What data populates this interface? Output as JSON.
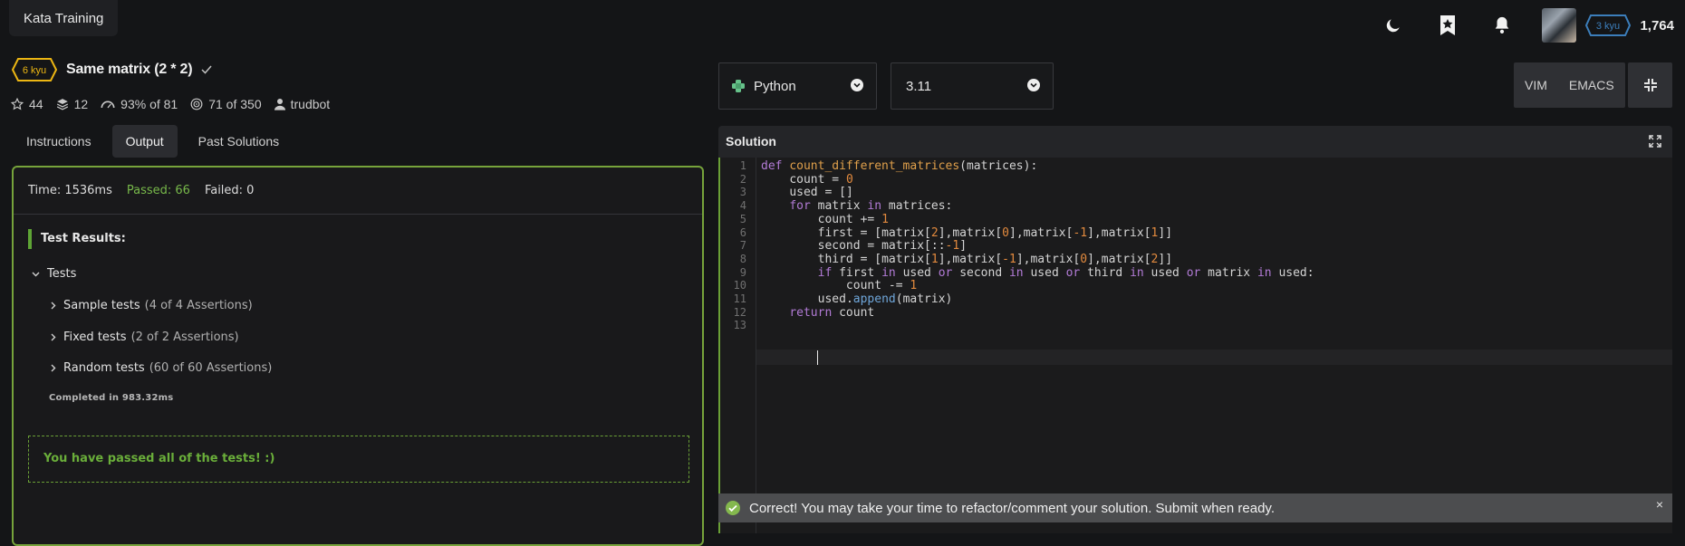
{
  "app": {
    "brand": "Kata Training"
  },
  "user": {
    "rank": "3 kyu",
    "honor": "1,764"
  },
  "kata": {
    "rank": "6 kyu",
    "title": "Same matrix (2 * 2)",
    "stats": {
      "stars": "44",
      "collections": "12",
      "satisfaction": "93% of 81",
      "completions": "71 of 350",
      "author": "trudbot"
    }
  },
  "tabs": [
    "Instructions",
    "Output",
    "Past Solutions"
  ],
  "output": {
    "time": "Time: 1536ms",
    "passed": "Passed: 66",
    "failed": "Failed: 0",
    "results_title": "Test Results:",
    "tests_label": "Tests",
    "groups": [
      {
        "name": "Sample tests",
        "detail": "(4 of 4 Assertions)"
      },
      {
        "name": "Fixed tests",
        "detail": "(2 of 2 Assertions)"
      },
      {
        "name": "Random tests",
        "detail": "(60 of 60 Assertions)"
      }
    ],
    "completed": "Completed in 983.32ms",
    "pass_message": "You have passed all of the tests! :)"
  },
  "editor": {
    "language": "Python",
    "version": "3.11",
    "modes": [
      "VIM",
      "EMACS"
    ],
    "panel_title": "Solution",
    "line_numbers": [
      "1",
      "2",
      "3",
      "4",
      "5",
      "6",
      "7",
      "8",
      "9",
      "10",
      "11",
      "12",
      "13"
    ],
    "code_lines": [
      "def count_different_matrices(matrices):",
      "    count = 0",
      "    used = []",
      "    for matrix in matrices:",
      "        count += 1",
      "        first = [matrix[2],matrix[0],matrix[-1],matrix[1]]",
      "        second = matrix[::-1]",
      "        third = [matrix[1],matrix[-1],matrix[0],matrix[2]]",
      "        if first in used or second in used or third in used or matrix in used:",
      "            count -= 1",
      "        used.append(matrix)",
      "    return count",
      ""
    ]
  },
  "toast": {
    "message": "Correct! You may take your time to refactor/comment your solution. Submit when ready.",
    "close": "×"
  },
  "colors": {
    "accent_green": "#76a33b",
    "kyu6": "#ecb613",
    "kyu3": "#3c7ebb"
  }
}
